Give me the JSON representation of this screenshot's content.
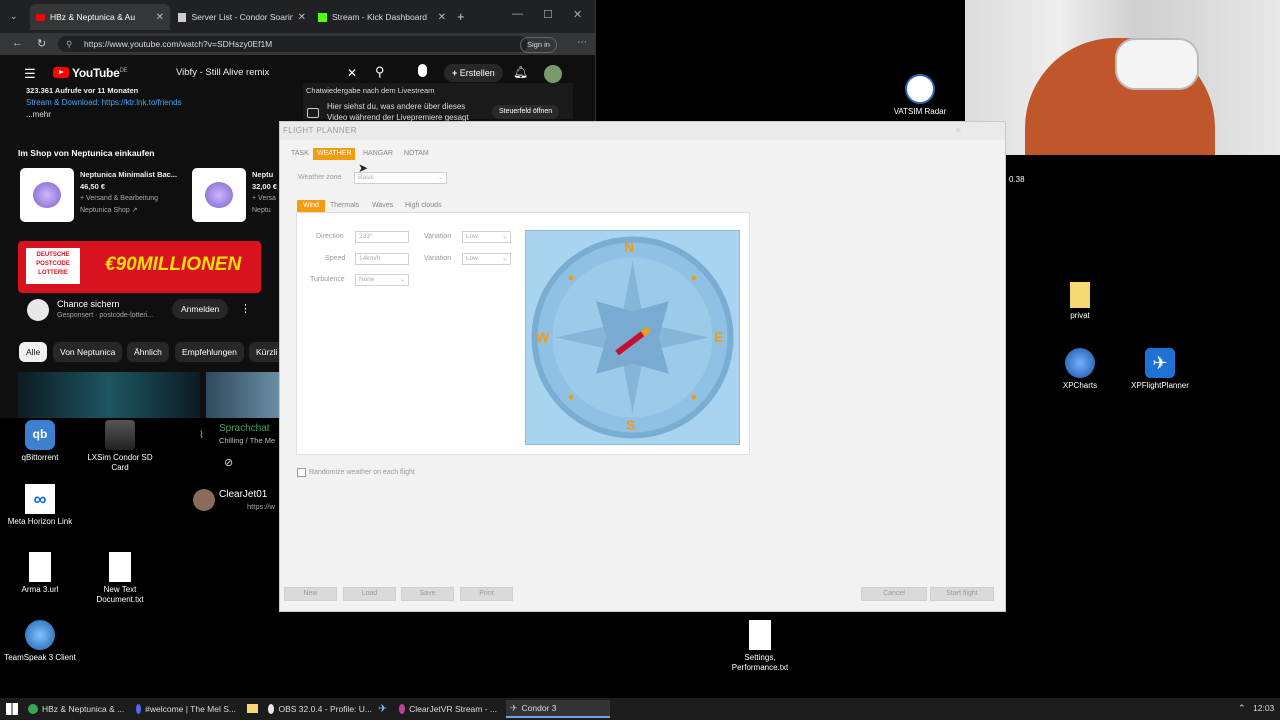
{
  "browser": {
    "tabs": [
      {
        "label": "HBz & Neptunica & Au"
      },
      {
        "label": "Server List - Condor Soaring"
      },
      {
        "label": "Stream - Kick Dashboard"
      }
    ],
    "url": "https://www.youtube.com/watch?v=SDHszy0Ef1M",
    "signin": "Sign in"
  },
  "youtube": {
    "logo": "YouTube",
    "logo_region": "DE",
    "search_query": "Vibfy - Still Alive remix",
    "create_label": "Erstellen",
    "desc_line1": "323.361 Aufrufe vor 11 Monaten",
    "desc_line2": "Stream & Download: https://ktr.lnk.to/friends",
    "desc_more": "...mehr",
    "live_header": "Chatwiedergabe nach dem Livestream",
    "live_line1": "Hier siehst du, was andere über dieses",
    "live_line2": "Video während der Livepremiere gesagt",
    "live_button": "Steuerfeld öffnen",
    "shop_title": "Im Shop von Neptunica einkaufen",
    "products": [
      {
        "name": "Neptunica Minimalist Bac...",
        "price": "46,50 €",
        "shipping": "+ Versand & Bearbeitung",
        "shop": "Neptunica Shop ↗"
      },
      {
        "name": "Neptu",
        "price": "32,00 €",
        "shipping": "+ Versa",
        "shop": "Neptu"
      }
    ],
    "ad_banner": "€90MILLIONEN",
    "ad_logo": "DEUTSCHE POSTCODE LOTTERIE",
    "ad_title": "Chance sichern",
    "ad_sponsor": "Gesponsert · postcode-lotteri...",
    "ad_button": "Anmelden",
    "chips": [
      "Alle",
      "Von Neptunica",
      "Ähnlich",
      "Empfehlungen",
      "Kürzli"
    ]
  },
  "desktop": {
    "icons": [
      {
        "label": "qBittorrent"
      },
      {
        "label": "LXSim Condor SD Card"
      },
      {
        "label": "Meta Horizon Link"
      },
      {
        "label": "Arma 3.url"
      },
      {
        "label": "New Text Document.txt"
      },
      {
        "label": "TeamSpeak 3 Client"
      },
      {
        "label": "VATSIM Radar"
      },
      {
        "label": "privat"
      },
      {
        "label": "XPCharts"
      },
      {
        "label": "XPFlightPlanner"
      },
      {
        "label": "Settings, Performance.txt"
      }
    ],
    "corner_text": "0.38"
  },
  "discord": {
    "channel": "Sprachchat",
    "subtitle": "Chilling / The Me",
    "user": "ClearJet01",
    "user_status": "https://w"
  },
  "flight_planner": {
    "title": "FLIGHT PLANNER",
    "tabs": [
      "TASK",
      "WEATHER",
      "HANGAR",
      "NOTAM"
    ],
    "weather_zone_label": "Weather zone",
    "weather_zone_value": "Basic",
    "subtabs": [
      "Wind",
      "Thermals",
      "Waves",
      "High clouds"
    ],
    "direction_label": "Direction",
    "direction_value": "233°",
    "speed_label": "Speed",
    "speed_value": "14km/h",
    "turbulence_label": "Turbulence",
    "turbulence_value": "None",
    "variation_label": "Variation",
    "variation1_value": "Low",
    "variation2_value": "Low",
    "compass": {
      "n": "N",
      "e": "E",
      "s": "S",
      "w": "W",
      "wind_direction_deg": 233
    },
    "randomize_label": "Randomize weather on each flight",
    "buttons_left": [
      "New",
      "Load",
      "Save",
      "Print"
    ],
    "buttons_right": [
      "Cancel",
      "Start flight"
    ]
  },
  "taskbar": {
    "items": [
      {
        "label": "HBz & Neptunica & ..."
      },
      {
        "label": "#welcome | The Mel S..."
      },
      {
        "label": "OBS 32.0.4 - Profile: U..."
      },
      {
        "label": "ClearJetVR Stream - ..."
      },
      {
        "label": "Condor 3"
      }
    ],
    "time": "12:03"
  },
  "colors": {
    "accent_orange": "#f39c12",
    "compass_bg": "#a9d4ef",
    "youtube_red": "#ff0000"
  }
}
